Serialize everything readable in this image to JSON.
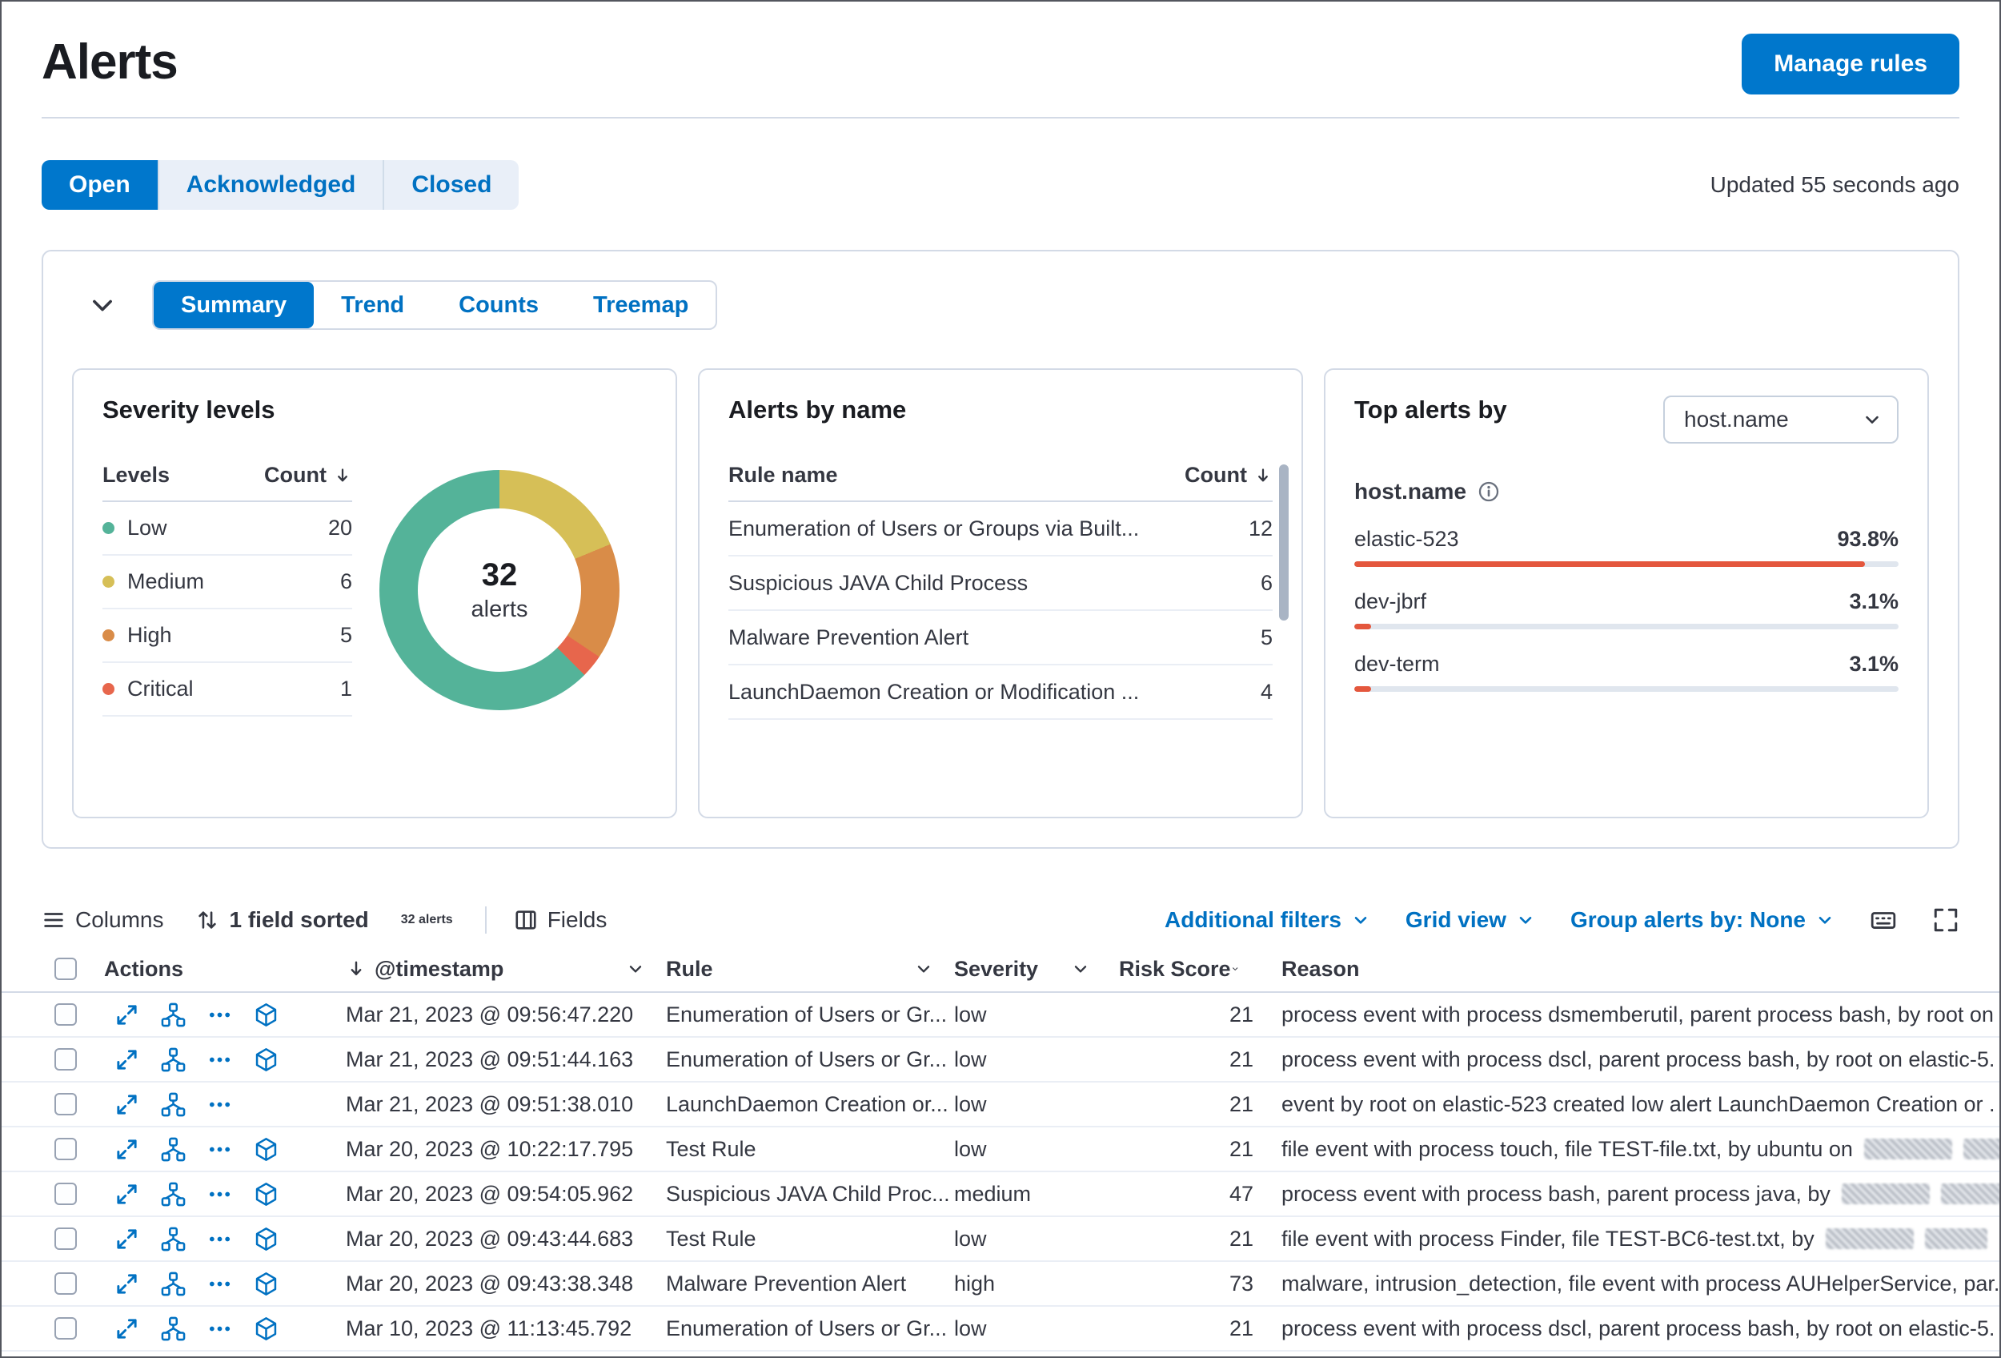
{
  "header": {
    "title": "Alerts",
    "manage_rules_label": "Manage rules"
  },
  "status_bar": {
    "filters": [
      {
        "label": "Open",
        "active": true
      },
      {
        "label": "Acknowledged",
        "active": false
      },
      {
        "label": "Closed",
        "active": false
      }
    ],
    "updated_text": "Updated 55 seconds ago"
  },
  "viz_panel": {
    "tabs": [
      {
        "label": "Summary",
        "active": true
      },
      {
        "label": "Trend",
        "active": false
      },
      {
        "label": "Counts",
        "active": false
      },
      {
        "label": "Treemap",
        "active": false
      }
    ],
    "severity_card": {
      "title": "Severity levels",
      "col_levels": "Levels",
      "col_count": "Count",
      "rows": [
        {
          "label": "Low",
          "count": 20,
          "color": "#54B399"
        },
        {
          "label": "Medium",
          "count": 6,
          "color": "#D6BF57"
        },
        {
          "label": "High",
          "count": 5,
          "color": "#D98C48"
        },
        {
          "label": "Critical",
          "count": 1,
          "color": "#E7664C"
        }
      ],
      "donut": {
        "total": "32",
        "total_label": "alerts"
      }
    },
    "alerts_by_name_card": {
      "title": "Alerts by name",
      "col_rule": "Rule name",
      "col_count": "Count",
      "rows": [
        {
          "name": "Enumeration of Users or Groups via Built...",
          "count": 12
        },
        {
          "name": "Suspicious JAVA Child Process",
          "count": 6
        },
        {
          "name": "Malware Prevention Alert",
          "count": 5
        },
        {
          "name": "LaunchDaemon Creation or Modification ...",
          "count": 4
        }
      ]
    },
    "top_alerts_card": {
      "title": "Top alerts by",
      "select_value": "host.name",
      "field_label": "host.name",
      "bar_color": "#E4573D",
      "track_color": "#E0E6EE",
      "rows": [
        {
          "name": "elastic-523",
          "pct": "93.8%",
          "fill": 93.8
        },
        {
          "name": "dev-jbrf",
          "pct": "3.1%",
          "fill": 3.1
        },
        {
          "name": "dev-term",
          "pct": "3.1%",
          "fill": 3.1
        }
      ]
    }
  },
  "chart_data": [
    {
      "type": "pie",
      "title": "Severity levels",
      "categories": [
        "Low",
        "Medium",
        "High",
        "Critical"
      ],
      "values": [
        20,
        6,
        5,
        1
      ],
      "center_label": "32 alerts"
    },
    {
      "type": "table",
      "title": "Alerts by name",
      "columns": [
        "Rule name",
        "Count"
      ],
      "rows": [
        [
          "Enumeration of Users or Groups via Built...",
          12
        ],
        [
          "Suspicious JAVA Child Process",
          6
        ],
        [
          "Malware Prevention Alert",
          5
        ],
        [
          "LaunchDaemon Creation or Modification ...",
          4
        ]
      ]
    },
    {
      "type": "bar",
      "title": "Top alerts by host.name",
      "categories": [
        "elastic-523",
        "dev-jbrf",
        "dev-term"
      ],
      "values": [
        93.8,
        3.1,
        3.1
      ],
      "unit": "%"
    }
  ],
  "grid_toolbar": {
    "columns_label": "Columns",
    "sorted_label": "1 field sorted",
    "alerts_count_label": "32 alerts",
    "fields_label": "Fields",
    "additional_filters_label": "Additional filters",
    "grid_view_label": "Grid view",
    "group_by_label": "Group alerts by: None"
  },
  "alerts_table": {
    "columns": [
      "Actions",
      "@timestamp",
      "Rule",
      "Severity",
      "Risk Score",
      "Reason"
    ],
    "rows": [
      {
        "timestamp": "Mar 21, 2023 @ 09:56:47.220",
        "rule": "Enumeration of Users or Gr...",
        "severity": "low",
        "risk_score": "21",
        "reason": "process event with process dsmemberutil, parent process bash, by root on",
        "has_analyze": true,
        "redacted_blocks": 0
      },
      {
        "timestamp": "Mar 21, 2023 @ 09:51:44.163",
        "rule": "Enumeration of Users or Gr...",
        "severity": "low",
        "risk_score": "21",
        "reason": "process event with process dscl, parent process bash, by root on elastic-5.",
        "has_analyze": true,
        "redacted_blocks": 0
      },
      {
        "timestamp": "Mar 21, 2023 @ 09:51:38.010",
        "rule": "LaunchDaemon Creation or...",
        "severity": "low",
        "risk_score": "21",
        "reason": "event by root on elastic-523 created low alert LaunchDaemon Creation or .",
        "has_analyze": false,
        "redacted_blocks": 0
      },
      {
        "timestamp": "Mar 20, 2023 @ 10:22:17.795",
        "rule": "Test Rule",
        "severity": "low",
        "risk_score": "21",
        "reason": "file event with process touch, file TEST-file.txt, by ubuntu on",
        "has_analyze": true,
        "redacted_blocks": 2
      },
      {
        "timestamp": "Mar 20, 2023 @ 09:54:05.962",
        "rule": "Suspicious JAVA Child Proc...",
        "severity": "medium",
        "risk_score": "47",
        "reason": "process event with process bash, parent process java, by",
        "has_analyze": true,
        "redacted_blocks": 3
      },
      {
        "timestamp": "Mar 20, 2023 @ 09:43:44.683",
        "rule": "Test Rule",
        "severity": "low",
        "risk_score": "21",
        "reason": "file event with process Finder, file TEST-BC6-test.txt, by",
        "has_analyze": true,
        "redacted_blocks": 2
      },
      {
        "timestamp": "Mar 20, 2023 @ 09:43:38.348",
        "rule": "Malware Prevention Alert",
        "severity": "high",
        "risk_score": "73",
        "reason": "malware, intrusion_detection, file event with process AUHelperService, par.",
        "has_analyze": true,
        "redacted_blocks": 0
      },
      {
        "timestamp": "Mar 10, 2023 @ 11:13:45.792",
        "rule": "Enumeration of Users or Gr...",
        "severity": "low",
        "risk_score": "21",
        "reason": "process event with process dscl, parent process bash, by root on elastic-5.",
        "has_analyze": true,
        "redacted_blocks": 0
      }
    ]
  }
}
